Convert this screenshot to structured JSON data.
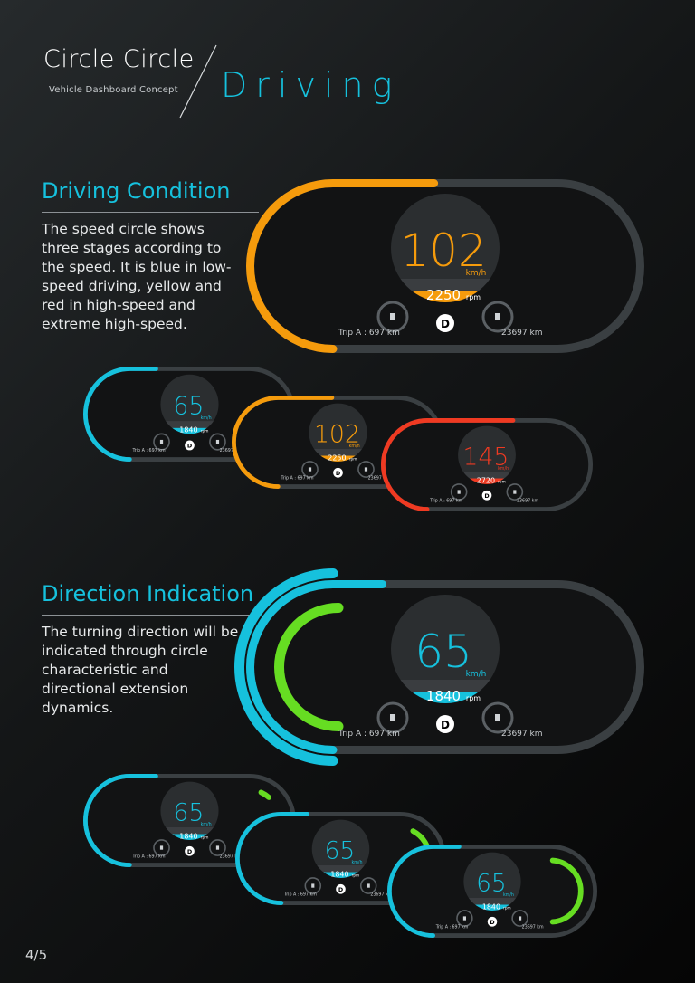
{
  "header": {
    "logo_text": "Circle Circle",
    "logo_subtitle": "Vehicle Dashboard Concept",
    "page_title": "Driving"
  },
  "sections": [
    {
      "title": "Driving Condition",
      "description": "The speed circle shows three stages according to the speed.  It is blue in low-speed driving, yellow and red in high-speed and extreme high-speed."
    },
    {
      "title": "Direction Indication",
      "description": "The turning direction will be indicated through circle characteristic and directional extension dynamics."
    }
  ],
  "colors": {
    "accent_blue": "#16c1dd",
    "orange": "#f59b0c",
    "red": "#ef3a22",
    "green": "#66dd22",
    "track": "#3a3f42",
    "panel": "#121314"
  },
  "dashboards": [
    {
      "id": "cond-large",
      "speed": "102",
      "speed_unit": "km/h",
      "rpm": "2250",
      "rpm_unit": "rpm",
      "gear": "D",
      "trip": "Trip A : 697 km",
      "odometer": "23697 km",
      "color": "#f59b0c",
      "speed_arc_fraction": 0.45,
      "turn": "none"
    },
    {
      "id": "cond-blue",
      "speed": "65",
      "speed_unit": "km/h",
      "rpm": "1840",
      "rpm_unit": "rpm",
      "gear": "D",
      "trip": "Trip A : 697 km",
      "odometer": "23697 km",
      "color": "#16c1dd",
      "speed_arc_fraction": 0.22,
      "turn": "none"
    },
    {
      "id": "cond-orange",
      "speed": "102",
      "speed_unit": "km/h",
      "rpm": "2250",
      "rpm_unit": "rpm",
      "gear": "D",
      "trip": "Trip A : 697 km",
      "odometer": "23697 km",
      "color": "#f59b0c",
      "speed_arc_fraction": 0.45,
      "turn": "none"
    },
    {
      "id": "cond-red",
      "speed": "145",
      "speed_unit": "km/h",
      "rpm": "2720",
      "rpm_unit": "rpm",
      "gear": "D",
      "trip": "Trip A : 697 km",
      "odometer": "23697 km",
      "color": "#ef3a22",
      "speed_arc_fraction": 0.72,
      "turn": "none"
    },
    {
      "id": "dir-large",
      "speed": "65",
      "speed_unit": "km/h",
      "rpm": "1840",
      "rpm_unit": "rpm",
      "gear": "D",
      "trip": "Trip A : 697 km",
      "odometer": "23697 km",
      "color": "#16c1dd",
      "speed_arc_fraction": 0.22,
      "turn": "left"
    },
    {
      "id": "dir-right-1",
      "speed": "65",
      "speed_unit": "km/h",
      "rpm": "1840",
      "rpm_unit": "rpm",
      "gear": "D",
      "trip": "Trip A : 697 km",
      "odometer": "23697 km",
      "color": "#16c1dd",
      "speed_arc_fraction": 0.22,
      "turn": "right-small"
    },
    {
      "id": "dir-right-2",
      "speed": "65",
      "speed_unit": "km/h",
      "rpm": "1840",
      "rpm_unit": "rpm",
      "gear": "D",
      "trip": "Trip A : 697 km",
      "odometer": "23697 km",
      "color": "#16c1dd",
      "speed_arc_fraction": 0.22,
      "turn": "right-medium"
    },
    {
      "id": "dir-right-3",
      "speed": "65",
      "speed_unit": "km/h",
      "rpm": "1840",
      "rpm_unit": "rpm",
      "gear": "D",
      "trip": "Trip A : 697 km",
      "odometer": "23697 km",
      "color": "#16c1dd",
      "speed_arc_fraction": 0.22,
      "turn": "right-large"
    }
  ],
  "page_number": "4/5"
}
